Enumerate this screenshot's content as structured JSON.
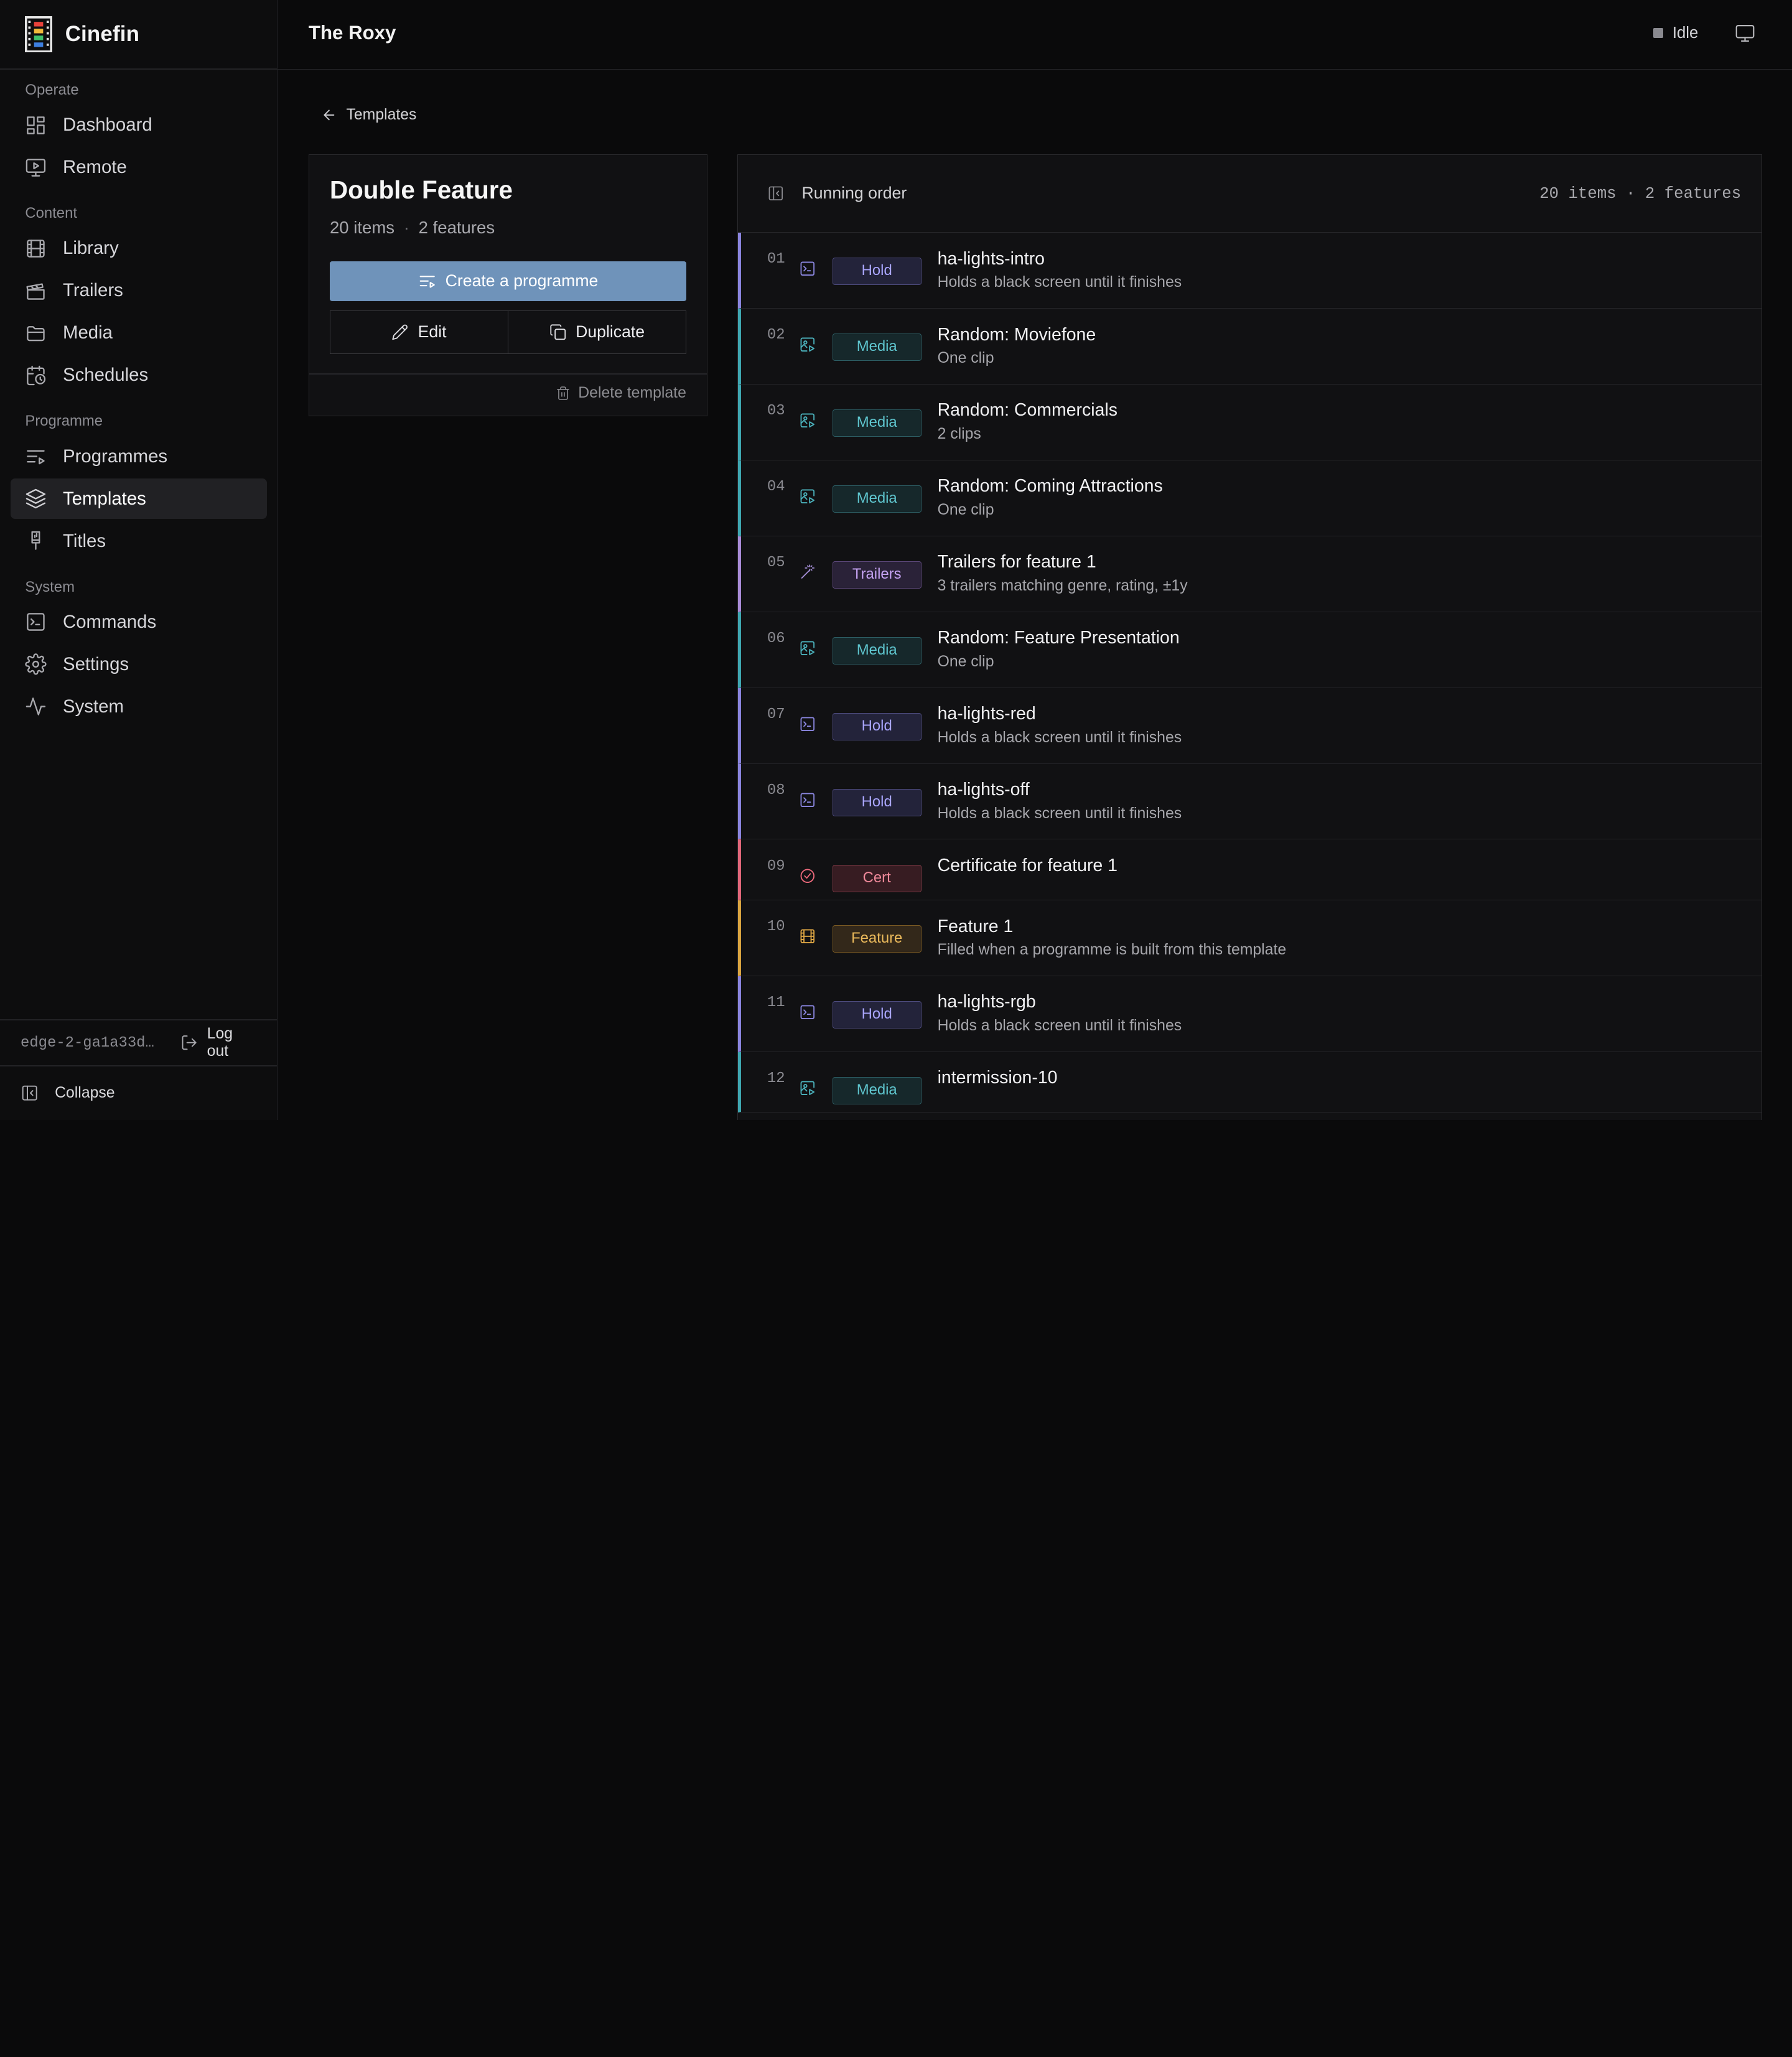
{
  "brand": {
    "name": "Cinefin"
  },
  "header": {
    "title": "The Roxy",
    "status": "Idle"
  },
  "sidebar": {
    "sections": [
      {
        "label": "Operate",
        "items": [
          {
            "label": "Dashboard",
            "icon": "dashboard-icon"
          },
          {
            "label": "Remote",
            "icon": "remote-icon"
          }
        ]
      },
      {
        "label": "Content",
        "items": [
          {
            "label": "Library",
            "icon": "film-icon"
          },
          {
            "label": "Trailers",
            "icon": "clapperboard-icon"
          },
          {
            "label": "Media",
            "icon": "folder-icon"
          },
          {
            "label": "Schedules",
            "icon": "calendar-clock-icon"
          }
        ]
      },
      {
        "label": "Programme",
        "items": [
          {
            "label": "Programmes",
            "icon": "list-play-icon"
          },
          {
            "label": "Templates",
            "icon": "layers-icon",
            "active": true
          },
          {
            "label": "Titles",
            "icon": "brush-icon"
          }
        ]
      },
      {
        "label": "System",
        "items": [
          {
            "label": "Commands",
            "icon": "terminal-icon"
          },
          {
            "label": "Settings",
            "icon": "gear-icon"
          },
          {
            "label": "System",
            "icon": "activity-icon"
          }
        ]
      }
    ],
    "host": "edge-2-ga1a33d0…",
    "logout_label": "Log out",
    "collapse_label": "Collapse"
  },
  "breadcrumb": {
    "back_label": "Templates"
  },
  "template": {
    "title": "Double Feature",
    "items_count": "20 items",
    "features_count": "2 features",
    "create_label": "Create a programme",
    "edit_label": "Edit",
    "duplicate_label": "Duplicate",
    "delete_label": "Delete template"
  },
  "running_order": {
    "title": "Running order",
    "summary": "20 items · 2 features",
    "items": [
      {
        "num": "01",
        "kind": "hold",
        "badge": "Hold",
        "title": "ha-lights-intro",
        "sub": "Holds a black screen until it finishes"
      },
      {
        "num": "02",
        "kind": "media",
        "badge": "Media",
        "title": "Random: Moviefone",
        "sub": "One clip"
      },
      {
        "num": "03",
        "kind": "media",
        "badge": "Media",
        "title": "Random: Commercials",
        "sub": "2 clips"
      },
      {
        "num": "04",
        "kind": "media",
        "badge": "Media",
        "title": "Random: Coming Attractions",
        "sub": "One clip"
      },
      {
        "num": "05",
        "kind": "trailers",
        "badge": "Trailers",
        "title": "Trailers for feature 1",
        "sub": "3 trailers matching genre, rating, ±1y"
      },
      {
        "num": "06",
        "kind": "media",
        "badge": "Media",
        "title": "Random: Feature Presentation",
        "sub": "One clip"
      },
      {
        "num": "07",
        "kind": "hold",
        "badge": "Hold",
        "title": "ha-lights-red",
        "sub": "Holds a black screen until it finishes"
      },
      {
        "num": "08",
        "kind": "hold",
        "badge": "Hold",
        "title": "ha-lights-off",
        "sub": "Holds a black screen until it finishes"
      },
      {
        "num": "09",
        "kind": "cert",
        "badge": "Cert",
        "title": "Certificate for feature 1",
        "sub": ""
      },
      {
        "num": "10",
        "kind": "feature",
        "badge": "Feature",
        "title": "Feature 1",
        "sub": "Filled when a programme is built from this template"
      },
      {
        "num": "11",
        "kind": "hold",
        "badge": "Hold",
        "title": "ha-lights-rgb",
        "sub": "Holds a black screen until it finishes"
      },
      {
        "num": "12",
        "kind": "media",
        "badge": "Media",
        "title": "intermission-10",
        "sub": ""
      }
    ]
  }
}
